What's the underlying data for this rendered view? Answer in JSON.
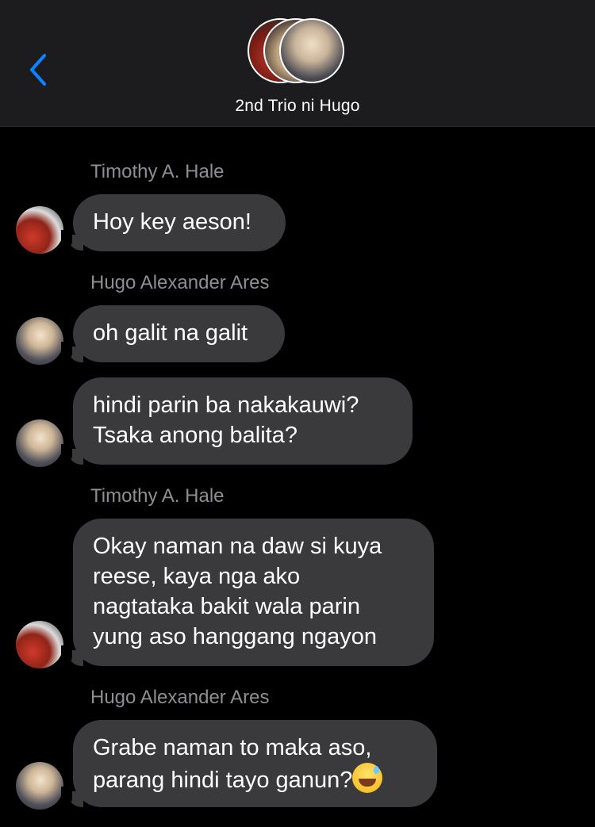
{
  "header": {
    "title": "2nd Trio ni Hugo",
    "back_icon": "chevron-left-icon",
    "accent_color": "#0a84ff"
  },
  "messages": [
    {
      "sender": "Timothy A. Hale",
      "lines": [
        "Hoy key aeson!"
      ]
    },
    {
      "sender": "Hugo Alexander Ares",
      "lines": [
        "oh galit na galit"
      ]
    },
    {
      "sender": "",
      "lines": [
        "hindi parin ba nakakauwi?",
        "Tsaka anong balita?"
      ]
    },
    {
      "sender": "Timothy A. Hale",
      "lines": [
        "Okay naman na daw si kuya",
        "reese, kaya nga ako",
        "nagtataka bakit wala parin",
        "yung aso hanggang ngayon"
      ]
    },
    {
      "sender": "Hugo Alexander Ares",
      "lines": [
        "Grabe naman to maka aso,",
        "parang hindi tayo ganun?"
      ],
      "emoji": "grinning-face-with-sweat"
    }
  ]
}
